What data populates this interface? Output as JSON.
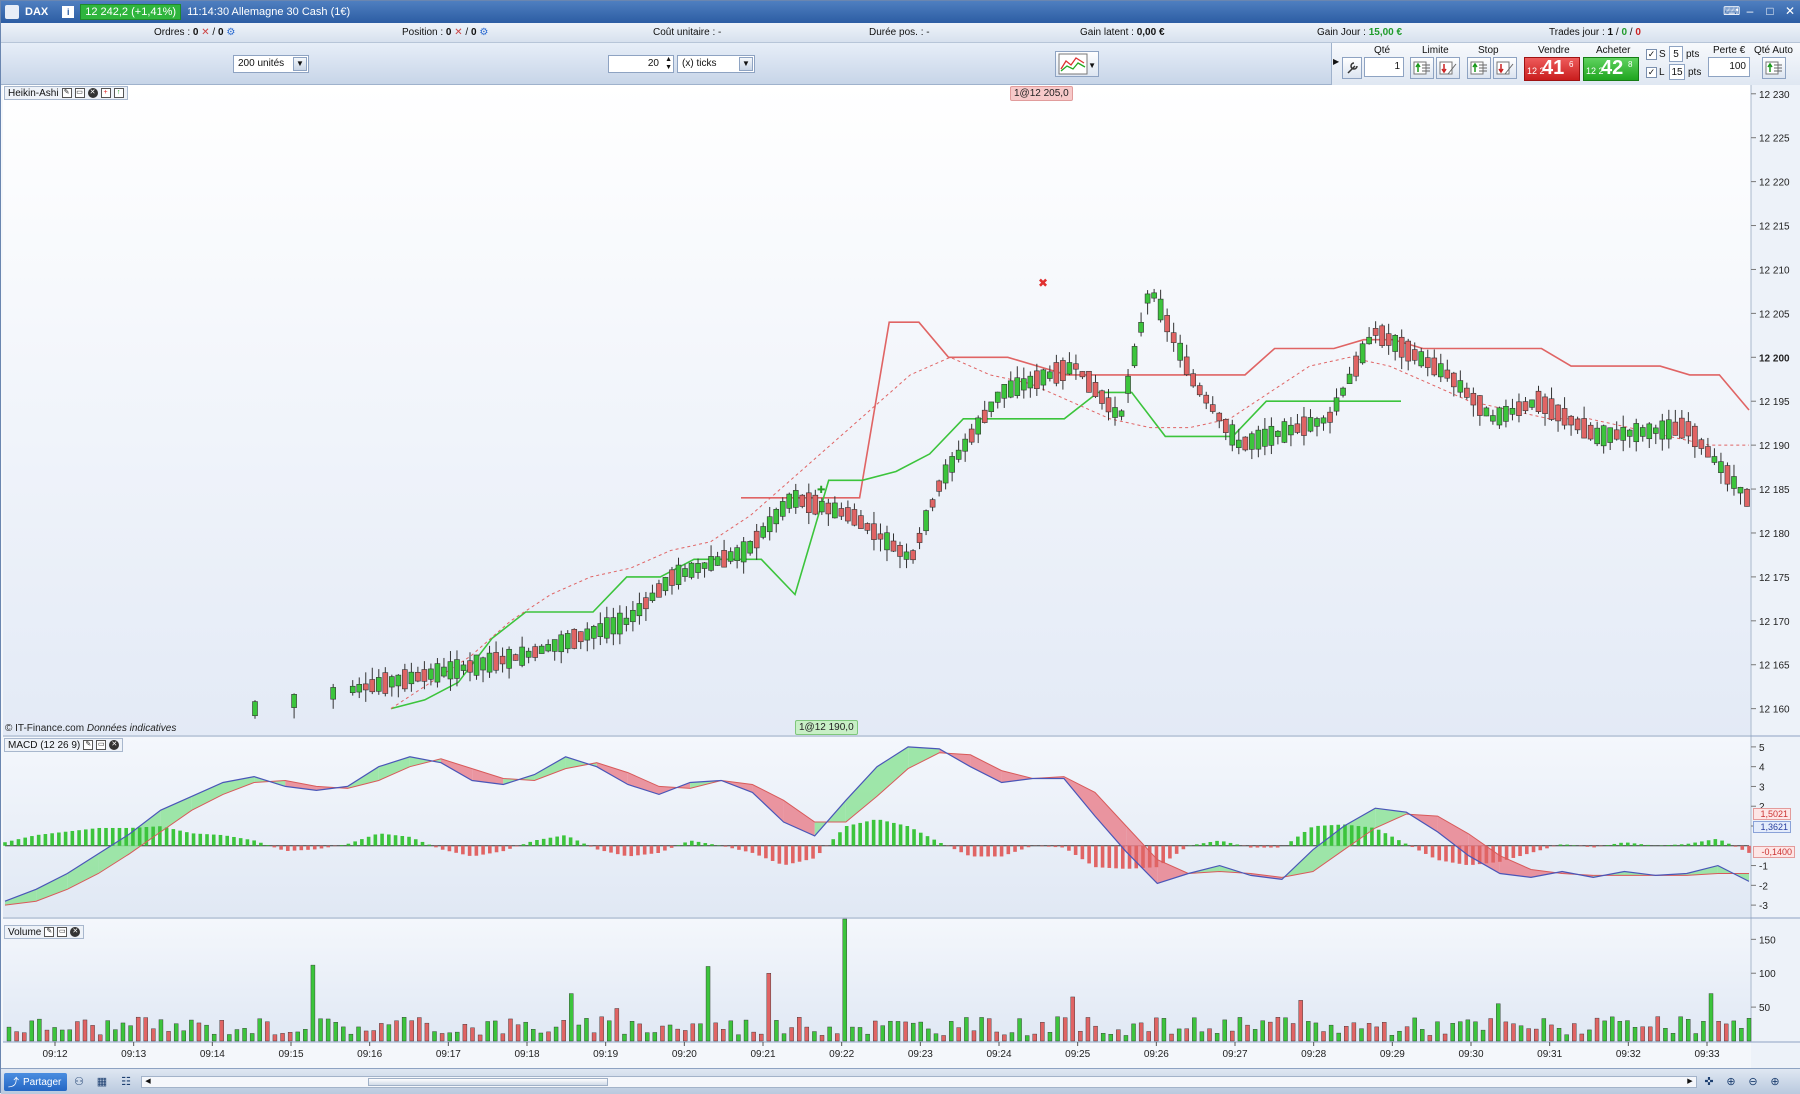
{
  "titlebar": {
    "instrument": "DAX",
    "info_icon": "i",
    "price_badge": "12 242,2 (+1,41%)",
    "time_and_name": "11:14:30 Allemagne 30 Cash (1€)"
  },
  "infobar": {
    "ordres_label": "Ordres :",
    "ordres_value": "0",
    "ordres_value2": "0",
    "position_label": "Position :",
    "position_value": "0",
    "position_value2": "0",
    "cout_label": "Coût unitaire :",
    "cout_value": "-",
    "duree_label": "Durée pos. :",
    "duree_value": "-",
    "gain_latent_label": "Gain latent :",
    "gain_latent_value": "0,00 €",
    "gain_jour_label": "Gain Jour :",
    "gain_jour_value": "15,00 €",
    "trades_label": "Trades jour :",
    "trades_value_1": "1",
    "trades_value_2": "0",
    "trades_value_3": "0"
  },
  "toolbar": {
    "units_select": "200 unités",
    "ticks_value": "20",
    "ticks_select": "(x) ticks"
  },
  "order_panel": {
    "qte_label": "Qté",
    "qte_value": "1",
    "limite_label": "Limite",
    "stop_label": "Stop",
    "vendre_label": "Vendre",
    "acheter_label": "Acheter",
    "sell_small": "12 2",
    "sell_big": "41",
    "sell_sup": "6",
    "buy_small": "12 2",
    "buy_big": "42",
    "buy_sup": "8",
    "s_label": "S",
    "s_value": "5",
    "l_label": "L",
    "l_value": "15",
    "pts_label": "pts",
    "perte_label": "Perte €",
    "perte_value": "100",
    "qte_auto_label": "Qté Auto"
  },
  "panels": {
    "price_panel": "Heikin-Ashi",
    "macd_panel": "MACD (12 26 9)",
    "volume_panel": "Volume"
  },
  "order_labels": {
    "sell": "1@12 205,0",
    "buy": "1@12 190,0"
  },
  "copyright": "© IT-Finance.com",
  "copyright_note": "Données indicatives",
  "macd_readouts": {
    "macd": "1,5021",
    "signal": "1,3621",
    "hist": "-0,1400"
  },
  "bottombar": {
    "share_label": "Partager"
  },
  "chart_data": [
    {
      "type": "candlestick",
      "title": "Heikin-Ashi",
      "x_tick_labels": [
        "09:12",
        "09:13",
        "09:14",
        "09:15",
        "09:16",
        "09:17",
        "09:18",
        "09:19",
        "09:20",
        "09:21",
        "09:22",
        "09:23",
        "09:24",
        "09:25",
        "09:26",
        "09:27",
        "09:28",
        "09:29",
        "09:30",
        "09:31",
        "09:32",
        "09:33"
      ],
      "y_tick_labels": [
        "12 230",
        "12 225",
        "12 220",
        "12 215",
        "12 210",
        "12 205",
        "12 200",
        "12 195",
        "12 190",
        "12 185",
        "12 180",
        "12 175",
        "12 170",
        "12 165",
        "12 160"
      ],
      "ylim": [
        12157,
        12231
      ],
      "highlighted_price": "12 200",
      "colors": {
        "up": "#3cc43c",
        "down": "#e06464",
        "upper_band": "#e06464",
        "lower_band": "#3cc43c",
        "mid_band": "#e06464"
      },
      "upper_band": [
        12184,
        12184,
        12184,
        12184,
        12184,
        12204,
        12204,
        12200,
        12200,
        12200,
        12199,
        12198,
        12198,
        12198,
        12198,
        12198,
        12198,
        12198,
        12201,
        12201,
        12201,
        12202,
        12202,
        12201,
        12201,
        12201,
        12201,
        12201,
        12199,
        12199,
        12199,
        12199,
        12198,
        12198,
        12194
      ],
      "lower_band": [
        12160,
        12161,
        12163,
        12168,
        12171,
        12171,
        12171,
        12175,
        12175,
        12177,
        12177,
        12177,
        12173,
        12186,
        12186,
        12187,
        12189,
        12193,
        12193,
        12193,
        12193,
        12196,
        12196,
        12191,
        12191,
        12191,
        12195,
        12195,
        12195,
        12195,
        12195
      ],
      "mid_band": [
        12160,
        12163,
        12166,
        12170,
        12173,
        12175,
        12176,
        12178,
        12179,
        12182,
        12186,
        12190,
        12194,
        12198,
        12200,
        12198,
        12197,
        12195,
        12193,
        12192,
        12192,
        12193,
        12196,
        12199,
        12200,
        12199,
        12197,
        12195,
        12194,
        12193,
        12193,
        12192,
        12191,
        12190,
        12190
      ]
    },
    {
      "type": "macd",
      "title": "MACD (12 26 9)",
      "y_tick_labels": [
        "5",
        "4",
        "3",
        "2",
        "1",
        "-1",
        "-2",
        "-3"
      ],
      "ylim": [
        -3.5,
        5.5
      ],
      "macd_line": [
        -2.8,
        -2.2,
        -1.4,
        -0.4,
        0.6,
        1.8,
        2.5,
        3.2,
        3.5,
        3.0,
        2.8,
        3.0,
        4.0,
        4.5,
        4.2,
        3.3,
        3.1,
        3.6,
        4.5,
        4.0,
        3.1,
        2.6,
        3.2,
        3.3,
        2.7,
        1.2,
        0.5,
        2.3,
        4.0,
        5.0,
        4.9,
        4.0,
        3.2,
        3.4,
        3.4,
        1.5,
        -0.3,
        -1.9,
        -1.4,
        -1.0,
        -1.5,
        -1.7,
        -0.2,
        1.0,
        1.9,
        1.7,
        0.7,
        -0.5,
        -1.4,
        -1.6,
        -1.3,
        -1.6,
        -1.3,
        -1.5,
        -1.4,
        -1.0,
        -1.8
      ],
      "signal_line": [
        -3.0,
        -2.8,
        -2.2,
        -1.4,
        -0.4,
        0.7,
        1.8,
        2.6,
        3.2,
        3.3,
        3.0,
        2.9,
        3.3,
        4.0,
        4.4,
        3.9,
        3.4,
        3.3,
        3.9,
        4.2,
        3.7,
        3.0,
        2.9,
        3.3,
        3.1,
        2.3,
        1.2,
        1.2,
        2.5,
        3.9,
        4.7,
        4.6,
        3.8,
        3.4,
        3.5,
        2.7,
        1.0,
        -0.7,
        -1.4,
        -1.3,
        -1.4,
        -1.6,
        -1.3,
        -0.2,
        0.9,
        1.6,
        1.5,
        0.6,
        -0.5,
        -1.2,
        -1.4,
        -1.5,
        -1.5,
        -1.5,
        -1.5,
        -1.4,
        -1.4
      ]
    },
    {
      "type": "bar",
      "title": "Volume",
      "y_tick_labels": [
        "150",
        "100",
        "50"
      ],
      "ylim": [
        0,
        180
      ],
      "colors": {
        "up": "#3cc43c",
        "down": "#e06464"
      }
    }
  ]
}
